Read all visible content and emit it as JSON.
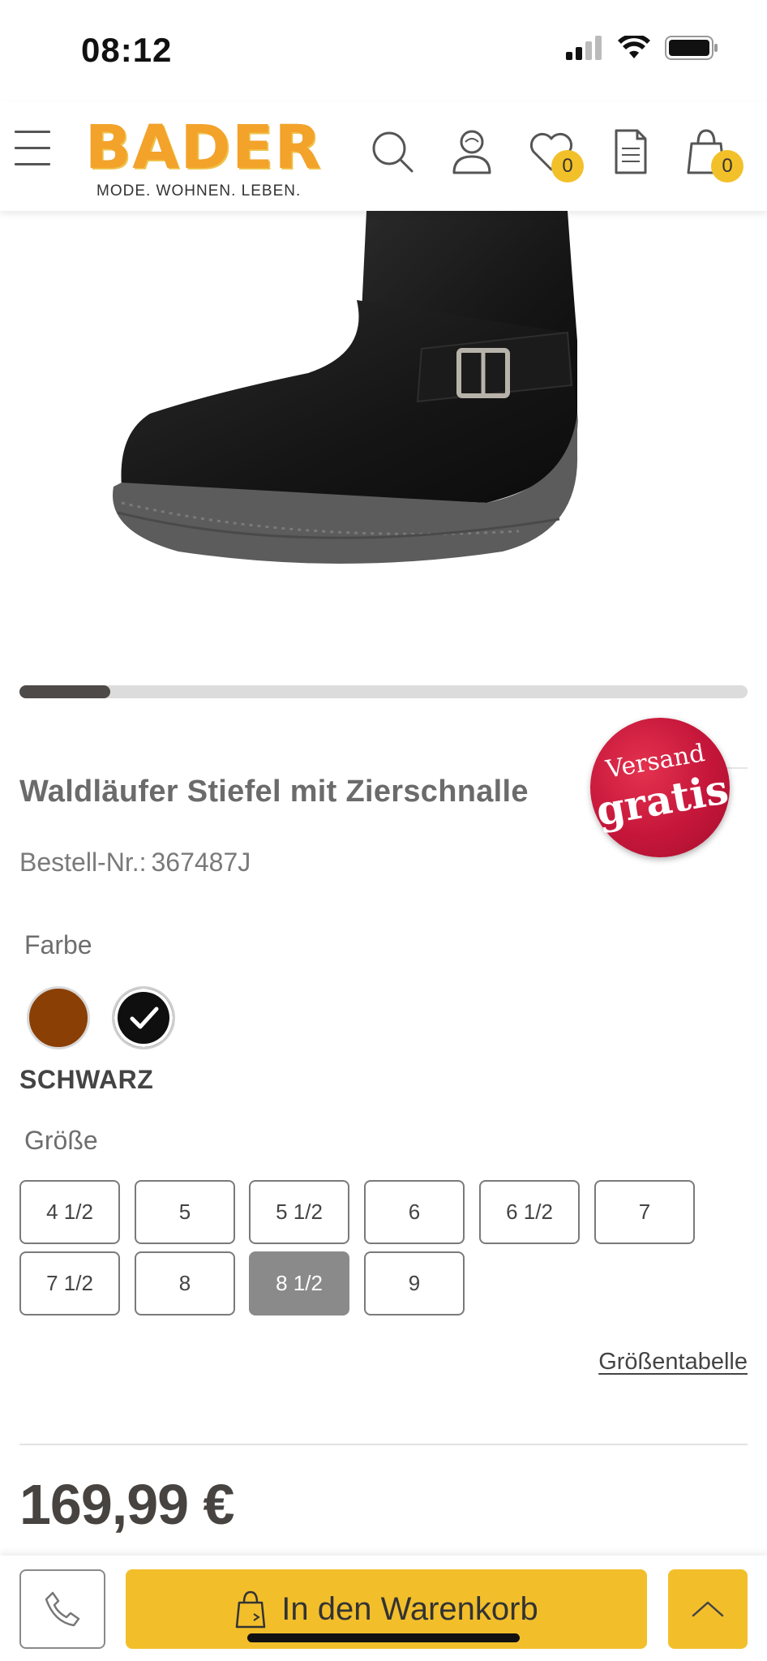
{
  "status_bar": {
    "time": "08:12",
    "icons": [
      "cellular-signal-icon",
      "wifi-icon",
      "battery-icon"
    ]
  },
  "header": {
    "menu_icon": "hamburger-menu-icon",
    "logo": {
      "word": "BADER",
      "tagline": "MODE. WOHNEN. LEBEN."
    },
    "icons": {
      "search": "search-icon",
      "account": "user-icon",
      "wishlist": "heart-icon",
      "notepad": "document-icon",
      "cart": "shopping-bag-icon"
    },
    "wishlist_count": "0",
    "cart_count": "0"
  },
  "gallery": {
    "progress": 0.125
  },
  "product": {
    "title": "Waldläufer Stiefel mit Zierschnalle",
    "order_label": "Bestell-Nr.:",
    "order_number": "367487J",
    "shipping_badge": {
      "line1": "Versand",
      "line2": "gratis"
    }
  },
  "color": {
    "label": "Farbe",
    "options": [
      {
        "name": "brown",
        "hex": "#8a3f05",
        "selected": false
      },
      {
        "name": "black",
        "hex": "#0f0f0f",
        "selected": true
      }
    ],
    "selected_name": "SCHWARZ"
  },
  "size": {
    "label": "Größe",
    "options": [
      "4 1/2",
      "5",
      "5 1/2",
      "6",
      "6 1/2",
      "7",
      "7 1/2",
      "8",
      "8 1/2",
      "9"
    ],
    "selected": "8 1/2",
    "table_link": "Größentabelle"
  },
  "price": "169,99 €",
  "bottom_bar": {
    "phone_icon": "phone-icon",
    "cart_button_label": "In den Warenkorb",
    "cart_button_icon": "shopping-bag-icon",
    "scroll_top_icon": "chevron-up-icon"
  },
  "colors": {
    "accent_yellow": "#f2bf2b",
    "logo_orange": "#f3a22a",
    "badge_red": "#c5163a"
  }
}
